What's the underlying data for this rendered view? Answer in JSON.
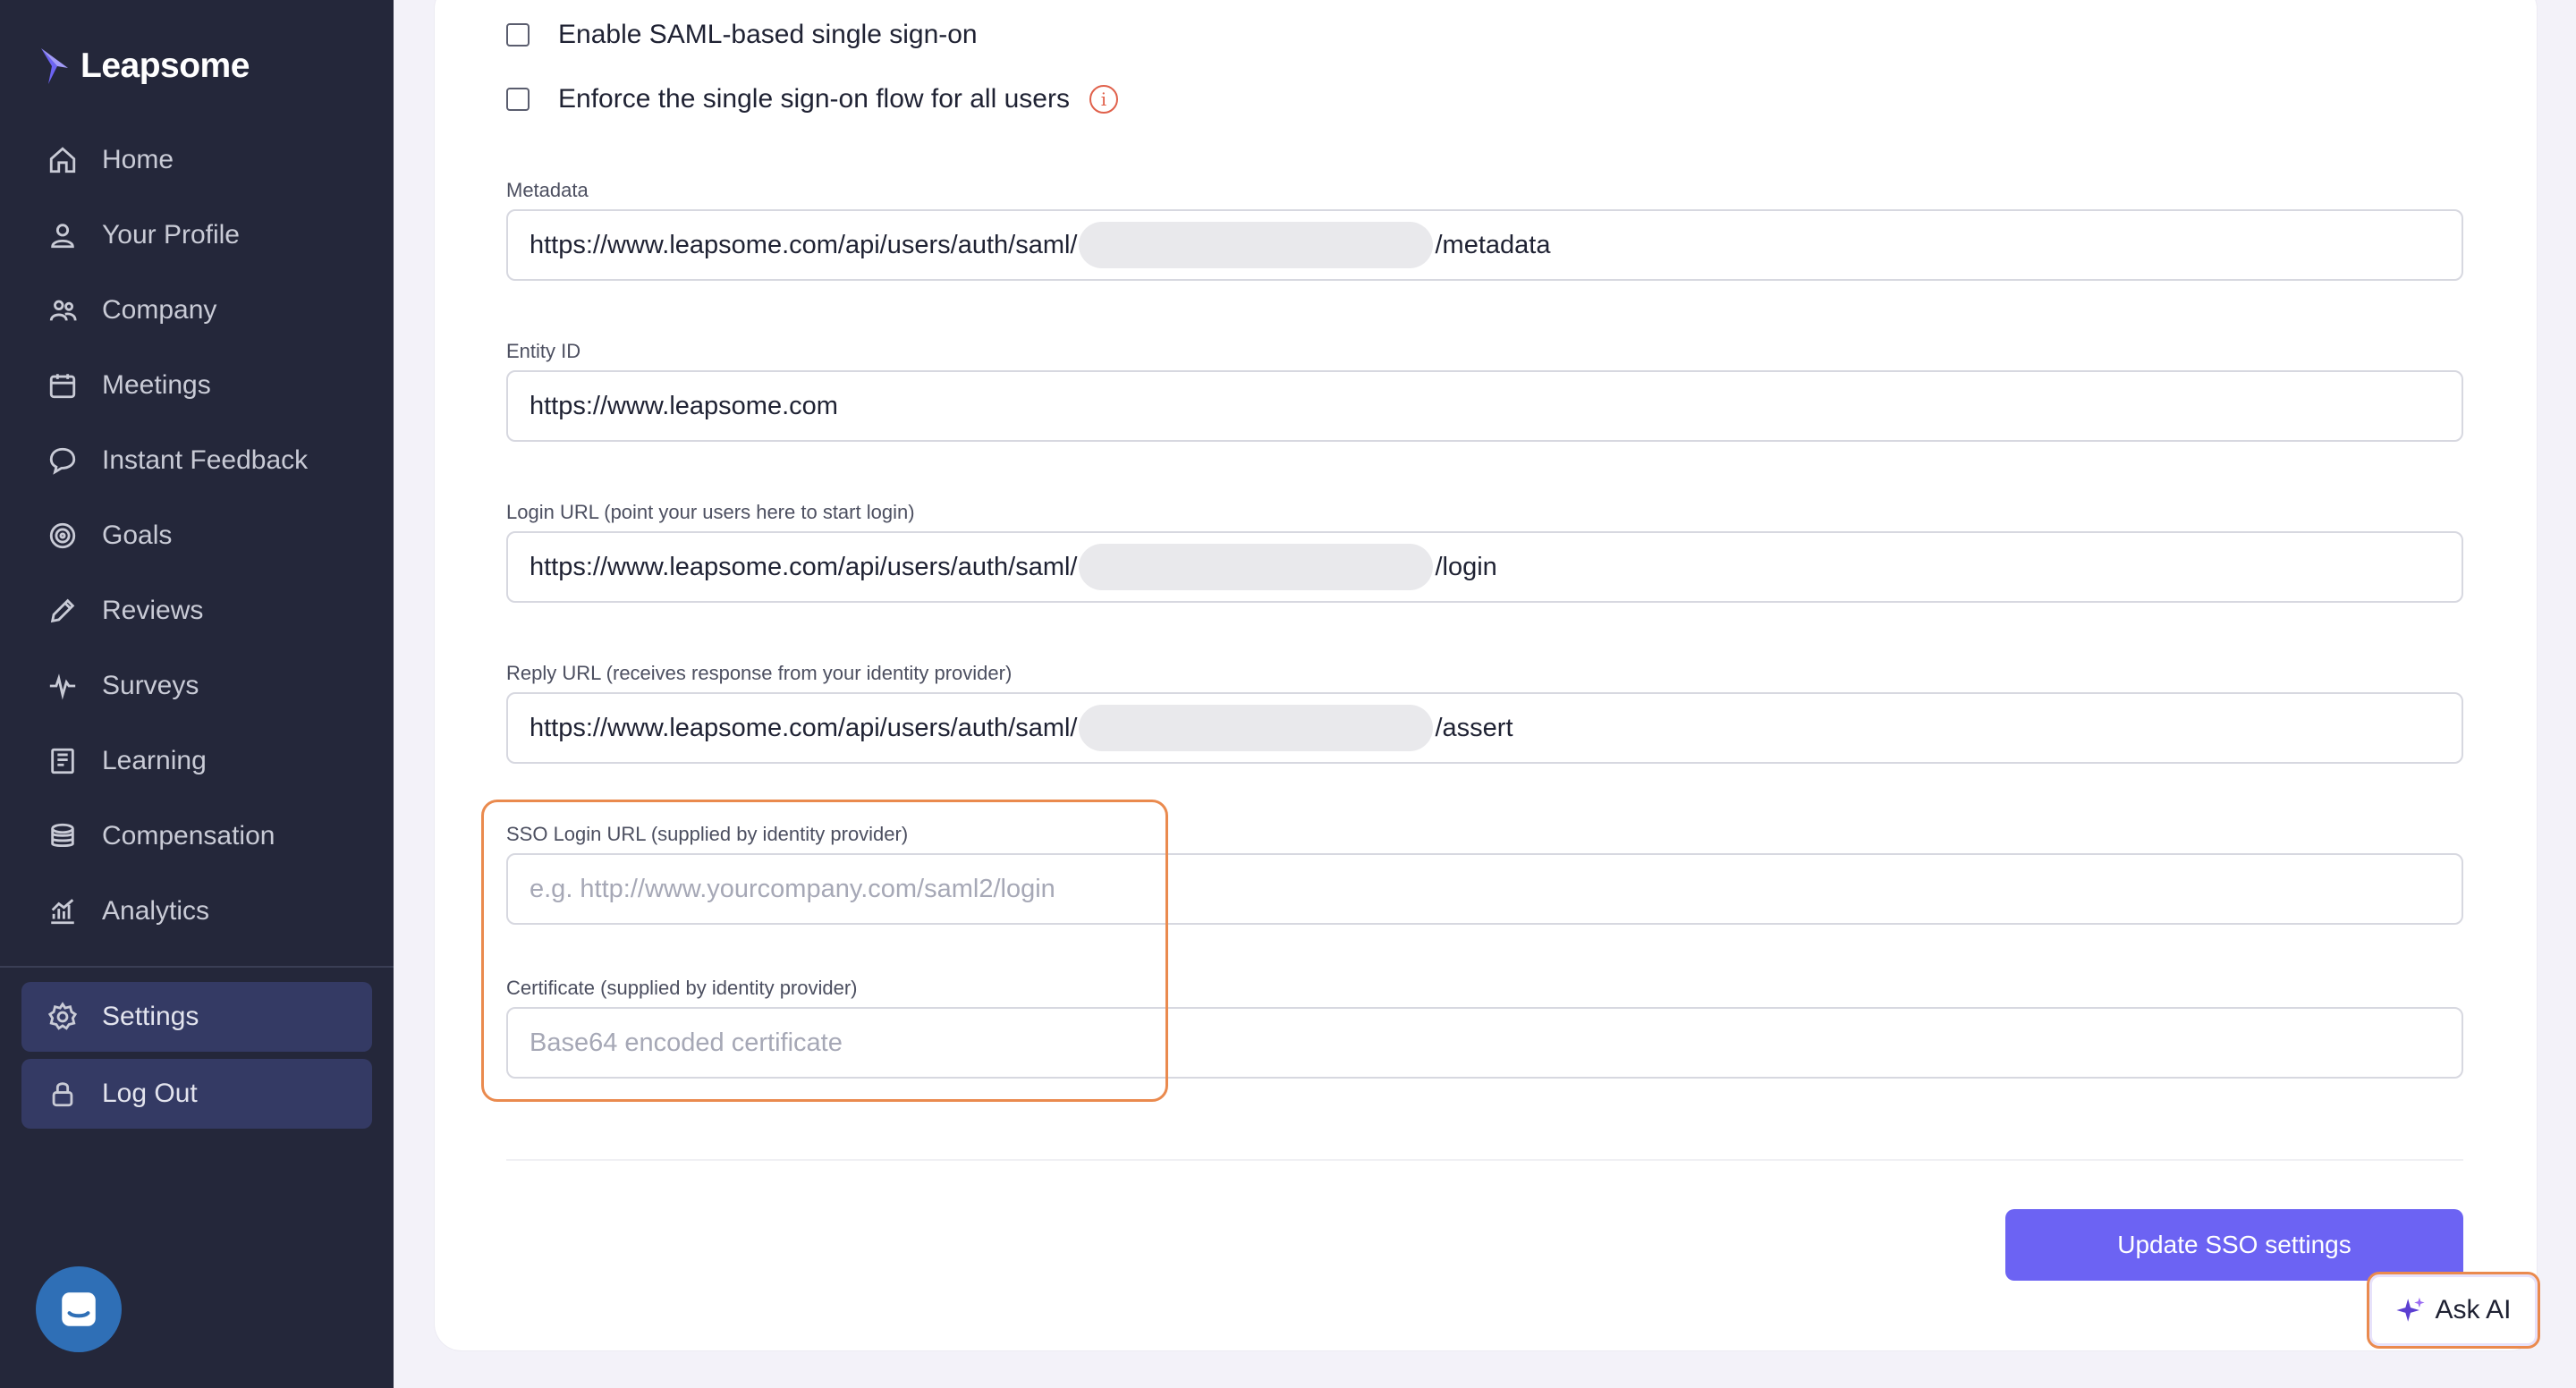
{
  "brand": {
    "name": "Leapsome"
  },
  "sidebar": {
    "items": [
      {
        "label": "Home",
        "icon": "home-icon"
      },
      {
        "label": "Your Profile",
        "icon": "user-icon"
      },
      {
        "label": "Company",
        "icon": "users-icon"
      },
      {
        "label": "Meetings",
        "icon": "calendar-icon"
      },
      {
        "label": "Instant Feedback",
        "icon": "chat-icon"
      },
      {
        "label": "Goals",
        "icon": "target-icon"
      },
      {
        "label": "Reviews",
        "icon": "pencil-icon"
      },
      {
        "label": "Surveys",
        "icon": "pulse-icon"
      },
      {
        "label": "Learning",
        "icon": "book-icon"
      },
      {
        "label": "Compensation",
        "icon": "coins-icon"
      },
      {
        "label": "Analytics",
        "icon": "analytics-icon"
      }
    ],
    "bottom": [
      {
        "label": "Settings",
        "icon": "gear-icon"
      },
      {
        "label": "Log Out",
        "icon": "lock-icon"
      }
    ]
  },
  "sso": {
    "enable_saml_label": "Enable SAML-based single sign-on",
    "enforce_label": "Enforce the single sign-on flow for all users",
    "info_glyph": "i",
    "metadata": {
      "label": "Metadata",
      "value_prefix": "https://www.leapsome.com/api/users/auth/saml/",
      "value_suffix": "/metadata"
    },
    "entity_id": {
      "label": "Entity ID",
      "value": "https://www.leapsome.com"
    },
    "login_url": {
      "label": "Login URL (point your users here to start login)",
      "value_prefix": "https://www.leapsome.com/api/users/auth/saml/",
      "value_suffix": "/login"
    },
    "reply_url": {
      "label": "Reply URL (receives response from your identity provider)",
      "value_prefix": "https://www.leapsome.com/api/users/auth/saml/",
      "value_suffix": "/assert"
    },
    "sso_login_url": {
      "label": "SSO Login URL (supplied by identity provider)",
      "placeholder": "e.g. http://www.yourcompany.com/saml2/login"
    },
    "certificate": {
      "label": "Certificate (supplied by identity provider)",
      "placeholder": "Base64 encoded certificate"
    },
    "update_button": "Update SSO settings"
  },
  "ask_ai": {
    "label": "Ask AI"
  },
  "colors": {
    "sidebar_bg": "#24273a",
    "accent": "#6c63f3",
    "highlight": "#ea8a4e",
    "chat_bubble": "#2f6fb6"
  }
}
